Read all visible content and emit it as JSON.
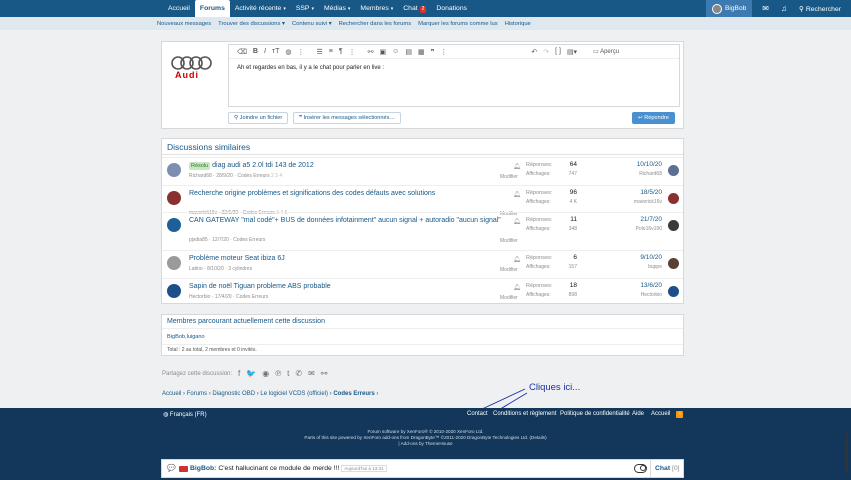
{
  "nav": {
    "items": [
      {
        "label": "Accueil"
      },
      {
        "label": "Forums",
        "active": true
      },
      {
        "label": "Activité récente",
        "chev": true
      },
      {
        "label": "SSP",
        "chev": true
      },
      {
        "label": "Médias",
        "chev": true
      },
      {
        "label": "Membres",
        "chev": true
      },
      {
        "label": "Chat",
        "badge": "2"
      },
      {
        "label": "Donations"
      }
    ],
    "user": "BigBob",
    "search": "Rechercher"
  },
  "subnav": [
    "Nouveaux messages",
    "Trouver des discussions ▾",
    "Contenu suivi ▾",
    "Rechercher dans les forums",
    "Marquer les forums comme lus",
    "Historique"
  ],
  "editor": {
    "text": "Ah et regardes en bas, il y a le chat pour parler en live :",
    "preview": "Aperçu",
    "attach": "Joindre un fichier",
    "insert": "Insérer les messages sélectionnés…",
    "reply": "Répondre",
    "logo_text": "Audi"
  },
  "similar": {
    "title": "Discussions similaires",
    "replies_label": "Réponses:",
    "views_label": "Affichages:",
    "modify_label": "Modifier",
    "rows": [
      {
        "tag": "Résolu",
        "title": "diag audi a5 2.0l tdi 143 de 2012",
        "meta": "Richard68 · 28/9/20 · Codes Erreurs",
        "pages": "2 3 4",
        "replies": "64",
        "views": "747",
        "date": "10/10/20",
        "user": "Richard68",
        "c": "#7c8fb0",
        "c2": "#5d6f92"
      },
      {
        "tag": "",
        "title": "Recherche origine problèmes et significations des codes défauts avec solutions",
        "meta": "maverick16v · 22/1/20 · Codes Erreurs",
        "pages": "3 4 5",
        "replies": "96",
        "views": "4 K",
        "date": "18/5/20",
        "user": "maverick16v",
        "c": "#8a3030",
        "c2": "#8a3030"
      },
      {
        "tag": "",
        "title": "CAN GATEWAY \"mal codé\"+ BUS de données infotainment\" aucun signal + autoradio \"aucun signal\"",
        "meta": "pjsdia85 · 12/7/20 · Codes Erreurs",
        "pages": "",
        "replies": "11",
        "views": "348",
        "date": "21/7/20",
        "user": "Polo16v190",
        "c": "#1e5f9a",
        "c2": "#3a3a3a"
      },
      {
        "tag": "",
        "title": "Problème moteur Seat ibiza 6J",
        "meta": "Latino · 8/10/20 · 3 cylindres",
        "pages": "",
        "replies": "6",
        "views": "157",
        "date": "9/10/20",
        "user": "buppe",
        "c": "#9a9a9a",
        "c2": "#5a4030"
      },
      {
        "tag": "",
        "title": "Sapin de noël Tiguan probleme ABS probable",
        "meta": "Hectorbio · 17/4/20 · Codes Erreurs",
        "pages": "",
        "replies": "18",
        "views": "898",
        "date": "13/6/20",
        "user": "Hectorbio",
        "c": "#1e4f8a",
        "c2": "#1e4f8a"
      }
    ]
  },
  "members": {
    "title": "Membres parcourant actuellement cette discussion",
    "list": "BigBob,luigano",
    "total": "Total : 2 au total, 2 membres et 0 invités."
  },
  "share": {
    "label": "Partagez cette discussion:"
  },
  "breadcrumb": {
    "items": [
      "Accueil",
      "Forums",
      "Diagnostic OBD",
      "Le logiciel VCDS (officiel)"
    ],
    "current": "Codes Erreurs"
  },
  "footer": {
    "lang": "Français (FR)",
    "links": [
      "Contact",
      "Conditions et règlement",
      "Politique de confidentialité",
      "Aide",
      "Accueil"
    ],
    "line1": "Forum software by XenForo® © 2010-2020 XenForo Ltd.",
    "line2": "Parts of this site powered by XenForo add-ons from DragonByte™ ©2011-2020 DragonByte Technologies Ltd. (Details)",
    "line3": "| Add-ons by ThemeHouse"
  },
  "chat": {
    "user": "BigBob",
    "message": "C'est hallucinant ce module de merde !!!",
    "time": "Aujourd'hui à 13:31",
    "label": "Chat",
    "count": "[0]"
  },
  "annotation": "Cliques ici..."
}
